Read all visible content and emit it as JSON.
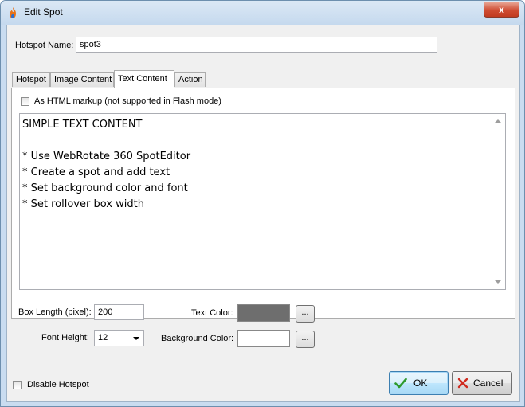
{
  "window": {
    "title": "Edit Spot",
    "close_glyph": "x",
    "app_icon": "flame-icon"
  },
  "hotspot_name": {
    "label": "Hotspot Name:",
    "value": "spot3"
  },
  "tabs": [
    {
      "label": "Hotspot"
    },
    {
      "label": "Image Content"
    },
    {
      "label": "Text Content",
      "active": true
    },
    {
      "label": "Action"
    }
  ],
  "text_content": {
    "html_checkbox_label": "As HTML markup (not supported in Flash mode)",
    "html_checked": false,
    "editor_text": "SIMPLE TEXT CONTENT\n\n* Use WebRotate 360 SpotEditor\n* Create a spot and add text\n* Set background color and font\n* Set rollover box width"
  },
  "settings": {
    "box_length_label": "Box Length (pixel):",
    "box_length_value": "200",
    "font_height_label": "Font Height:",
    "font_height_value": "12",
    "text_color_label": "Text Color:",
    "text_color_hex": "#6e6e6e",
    "background_color_label": "Background Color:",
    "background_color_hex": "#ffffff",
    "browse_label": "..."
  },
  "footer": {
    "disable_label": "Disable Hotspot",
    "disable_checked": false,
    "ok_label": "OK",
    "cancel_label": "Cancel",
    "ok_icon": "check-icon",
    "cancel_icon": "x-icon"
  },
  "colors": {
    "ok_check": "#2e9a2e",
    "cancel_x": "#d02b1f",
    "title_bar": "#c5d9ee"
  }
}
